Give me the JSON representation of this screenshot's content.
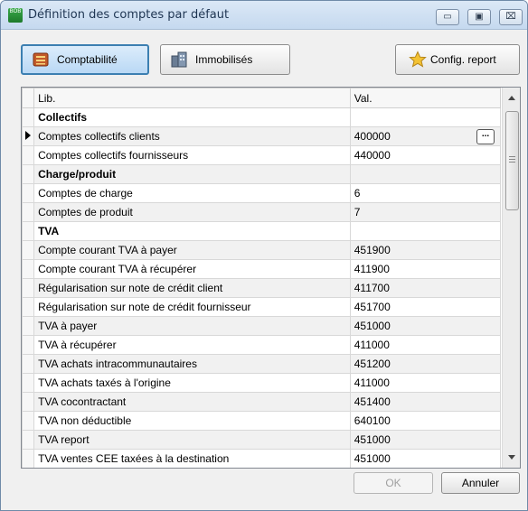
{
  "window": {
    "app_icon_text": "BOB",
    "title": "Définition des comptes par défaut",
    "controls": {
      "minimize": "▭",
      "maximize": "▣",
      "close": "⌧"
    }
  },
  "toolbar": {
    "comptabilite_label": "Comptabilité",
    "immobilises_label": "Immobilisés",
    "config_report_label": "Config. report"
  },
  "grid": {
    "columns": [
      "Lib.",
      "Val."
    ],
    "rows": [
      {
        "lib": "Collectifs",
        "val": "",
        "group": true
      },
      {
        "lib": "Comptes collectifs clients",
        "val": "400000",
        "group": false
      },
      {
        "lib": "Comptes collectifs fournisseurs",
        "val": "440000",
        "group": false
      },
      {
        "lib": "Charge/produit",
        "val": "",
        "group": true
      },
      {
        "lib": "Comptes de charge",
        "val": "6",
        "group": false
      },
      {
        "lib": "Comptes de produit",
        "val": "7",
        "group": false
      },
      {
        "lib": "TVA",
        "val": "",
        "group": true
      },
      {
        "lib": "Compte courant TVA à payer",
        "val": "451900",
        "group": false
      },
      {
        "lib": "Compte courant TVA à récupérer",
        "val": "411900",
        "group": false
      },
      {
        "lib": "Régularisation sur note de crédit client",
        "val": "411700",
        "group": false
      },
      {
        "lib": "Régularisation sur note de crédit fournisseur",
        "val": "451700",
        "group": false
      },
      {
        "lib": "TVA à payer",
        "val": "451000",
        "group": false
      },
      {
        "lib": "TVA à récupérer",
        "val": "411000",
        "group": false
      },
      {
        "lib": "TVA achats intracommunautaires",
        "val": "451200",
        "group": false
      },
      {
        "lib": "TVA achats taxés à l'origine",
        "val": "411000",
        "group": false
      },
      {
        "lib": "TVA cocontractant",
        "val": "451400",
        "group": false
      },
      {
        "lib": "TVA non déductible",
        "val": "640100",
        "group": false
      },
      {
        "lib": "TVA report",
        "val": "451000",
        "group": false
      },
      {
        "lib": "TVA ventes CEE taxées à la destination",
        "val": "451000",
        "group": false
      }
    ],
    "current_row_index": 1,
    "ellipsis_label": "..."
  },
  "footer": {
    "ok_label": "OK",
    "cancel_label": "Annuler"
  }
}
